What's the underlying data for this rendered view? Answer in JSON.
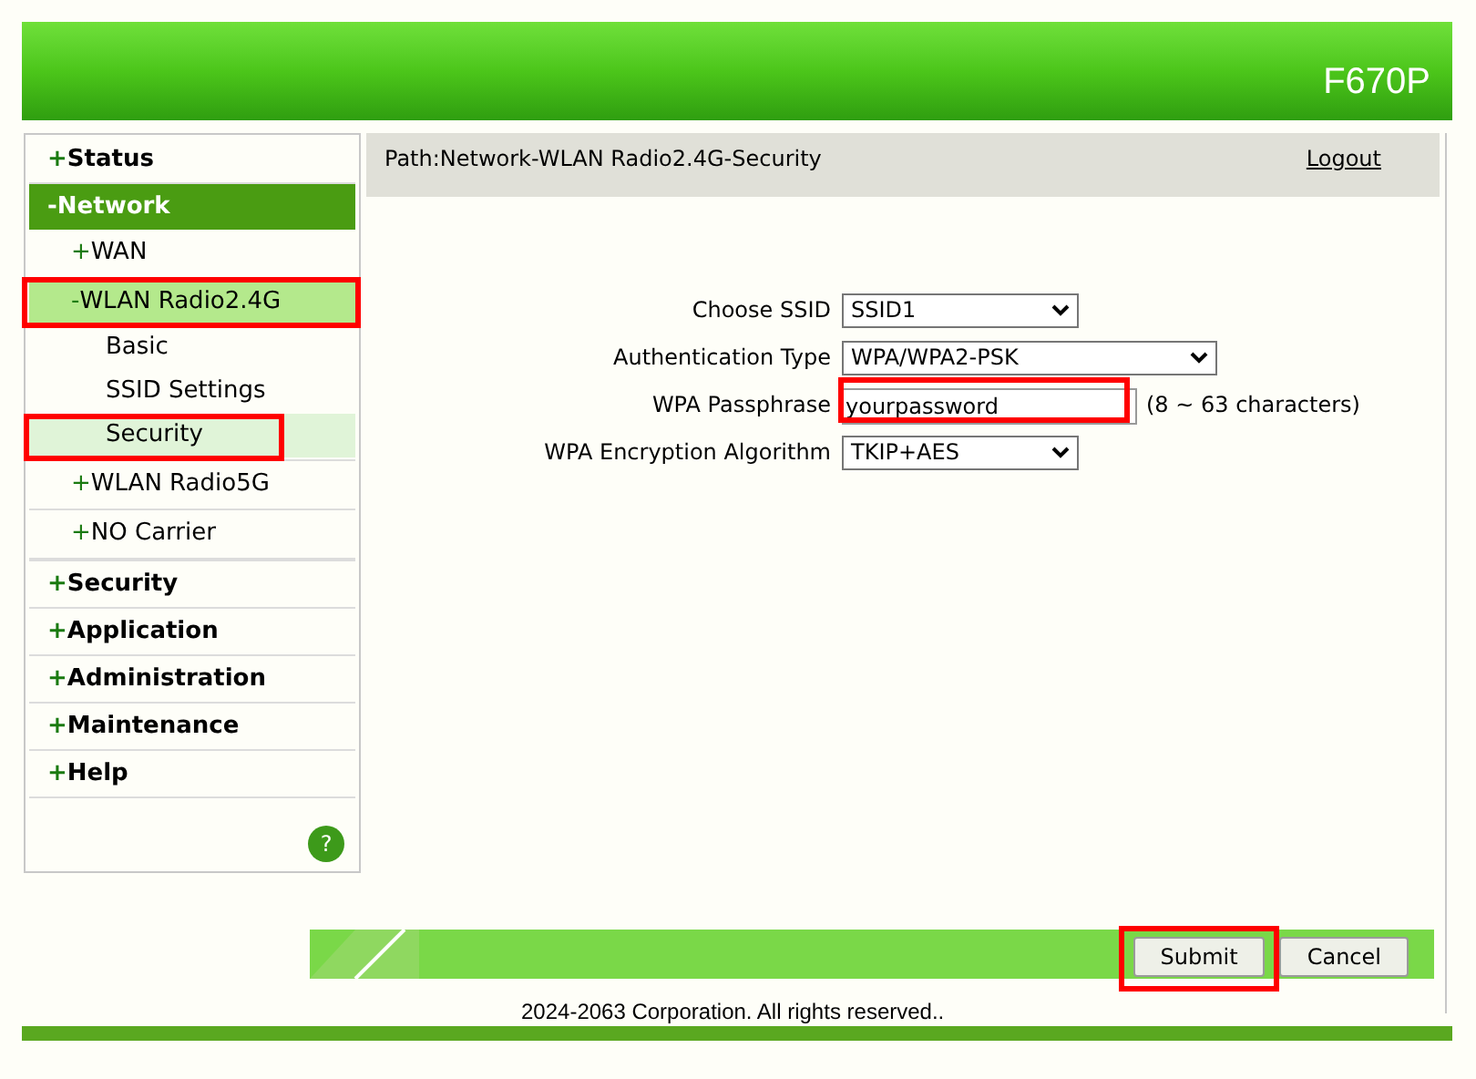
{
  "header": {
    "model": "F670P"
  },
  "sidebar": {
    "items": [
      {
        "marker": "+",
        "label": "Status",
        "selected": false
      },
      {
        "marker": "-",
        "label": "Network",
        "selected": true,
        "children": [
          {
            "marker": "+",
            "label": "WAN",
            "selected": false,
            "highlighted": false
          },
          {
            "marker": "-",
            "label": "WLAN Radio2.4G",
            "selected": true,
            "highlighted": true,
            "children": [
              {
                "label": "Basic",
                "selected": false,
                "highlighted": false
              },
              {
                "label": "SSID Settings",
                "selected": false,
                "highlighted": false
              },
              {
                "label": "Security",
                "selected": true,
                "highlighted": true
              }
            ]
          },
          {
            "marker": "+",
            "label": "WLAN Radio5G",
            "selected": false,
            "highlighted": false
          },
          {
            "marker": "+",
            "label": "NO Carrier",
            "selected": false,
            "highlighted": false
          }
        ]
      },
      {
        "marker": "+",
        "label": "Security",
        "selected": false
      },
      {
        "marker": "+",
        "label": "Application",
        "selected": false
      },
      {
        "marker": "+",
        "label": "Administration",
        "selected": false
      },
      {
        "marker": "+",
        "label": "Maintenance",
        "selected": false
      },
      {
        "marker": "+",
        "label": "Help",
        "selected": false
      }
    ],
    "help_icon": "?"
  },
  "path": "Path:Network-WLAN Radio2.4G-Security",
  "logout": "Logout",
  "form": [
    {
      "kind": "select",
      "label": "Choose SSID",
      "value": "SSID1",
      "highlighted": false
    },
    {
      "kind": "select",
      "label": "Authentication Type",
      "value": "WPA/WPA2-PSK",
      "highlighted": false
    },
    {
      "kind": "text",
      "label": "WPA Passphrase",
      "value": "yourpassword",
      "hint": "(8 ~ 63 characters)",
      "highlighted": true
    },
    {
      "kind": "select",
      "label": "WPA Encryption Algorithm",
      "value": "TKIP+AES",
      "highlighted": false
    }
  ],
  "buttons": [
    {
      "label": "Submit",
      "highlighted": true
    },
    {
      "label": "Cancel",
      "highlighted": false
    }
  ],
  "footer": "2024-2063 Corporation. All rights reserved.."
}
